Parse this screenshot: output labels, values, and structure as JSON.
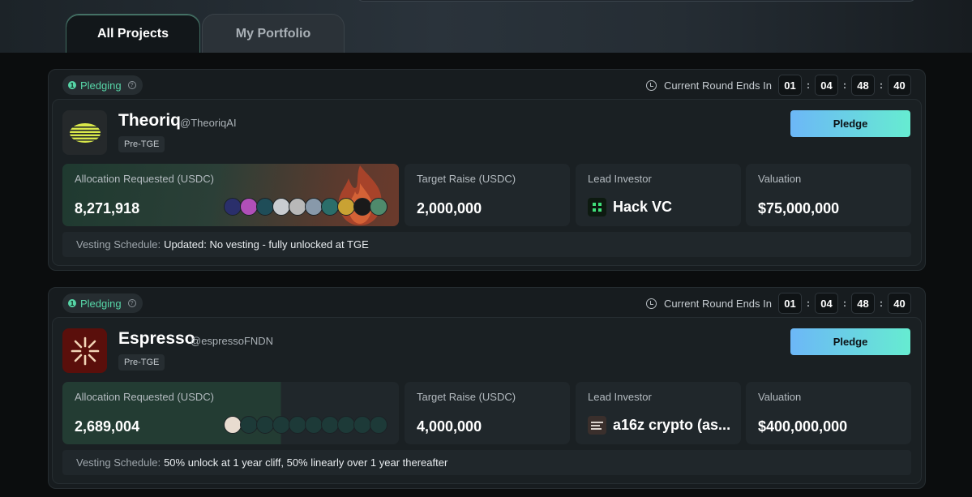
{
  "tabs": [
    {
      "label": "All Projects",
      "active": true
    },
    {
      "label": "My Portfolio",
      "active": false
    }
  ],
  "colors": {
    "accent_start": "#6cb7f7",
    "accent_end": "#66ecd1",
    "status_green": "#57d6a8"
  },
  "projects": [
    {
      "status": "Pledging",
      "status_num": "1",
      "round_label": "Current Round Ends In",
      "countdown": [
        "01",
        "04",
        "48",
        "40"
      ],
      "name": "Theoriq",
      "handle": "@TheoriqAI",
      "tag": "Pre-TGE",
      "pledge_label": "Pledge",
      "alloc_label": "Allocation Requested (USDC)",
      "alloc_value": "8,271,918",
      "target_label": "Target Raise (USDC)",
      "target_value": "2,000,000",
      "lead_label": "Lead Investor",
      "lead_name": "Hack VC",
      "lead_icon": "hack-vc-logo",
      "valuation_label": "Valuation",
      "valuation_value": "$75,000,000",
      "vesting_label": "Vesting Schedule:",
      "vesting_text": "Updated: No vesting - fully unlocked at TGE",
      "avatar_colors": [
        "#2a2f6b",
        "#b04fb8",
        "#1f4d58",
        "#c9ccd0",
        "#b8b8b8",
        "#8899aa",
        "#2b6e6a",
        "#c9a233",
        "#1a1a1a",
        "#4f8a6c"
      ]
    },
    {
      "status": "Pledging",
      "status_num": "1",
      "round_label": "Current Round Ends In",
      "countdown": [
        "01",
        "04",
        "48",
        "40"
      ],
      "name": "Espresso",
      "handle": "@espressoFNDN",
      "tag": "Pre-TGE",
      "pledge_label": "Pledge",
      "alloc_label": "Allocation Requested (USDC)",
      "alloc_value": "2,689,004",
      "target_label": "Target Raise (USDC)",
      "target_value": "4,000,000",
      "lead_label": "Lead Investor",
      "lead_name": "a16z crypto (as...",
      "lead_icon": "a16z-logo",
      "valuation_label": "Valuation",
      "valuation_value": "$400,000,000",
      "vesting_label": "Vesting Schedule:",
      "vesting_text": "50% unlock at 1 year cliff, 50% linearly over 1 year thereafter",
      "avatar_colors": [
        "#e8dcd0",
        "#1d3a38",
        "#1d3a38",
        "#1d3a38",
        "#1d3a38",
        "#1d3a38",
        "#1d3a38",
        "#1d3a38",
        "#1d3a38",
        "#1d3a38"
      ]
    }
  ]
}
